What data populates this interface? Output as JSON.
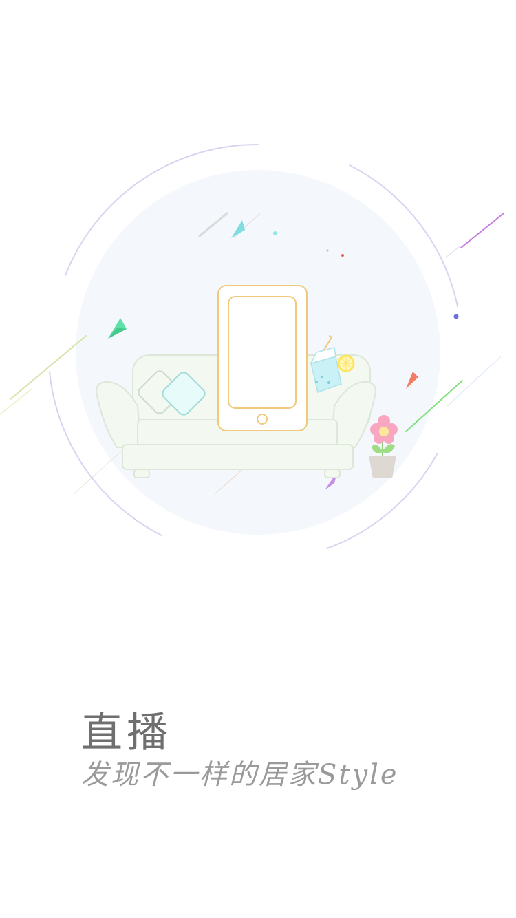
{
  "screen": {
    "title": "直播",
    "subtitle": "发现不一样的居家Style"
  },
  "illustration": {
    "name": "sofa-phone-illustration",
    "colors": {
      "background_circle": "#f4f7fc",
      "ring": "#d8d3f1",
      "phone_outline": "#f0c97d",
      "sofa_fill": "#f3f8f1",
      "sofa_outline": "#dbe8d8",
      "pillow_fill": "#e8fbfb",
      "pillow_outline": "#9fdcd8",
      "flower_pink": "#f7a8c0",
      "flower_center": "#fde79a",
      "pot": "#ddd9d2",
      "leaf": "#9fdc86",
      "cup": "#c9f1f6",
      "lemon": "#ffe45c",
      "gem_green": "#5fe0a6",
      "gem_orange": "#f47c63",
      "gem_purple": "#c48be8",
      "streak_purple": "#c77bdf",
      "streak_green": "#7ee07c"
    }
  }
}
